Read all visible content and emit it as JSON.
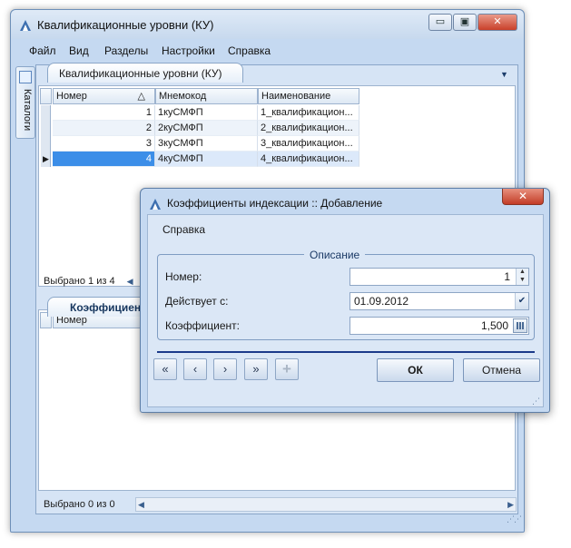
{
  "main_window": {
    "title": "Квалификационные уровни (КУ)",
    "caption_buttons": {
      "minimize": "▭",
      "maximize": "▣",
      "close": "✕"
    }
  },
  "menu": [
    "Файл",
    "Вид",
    "Разделы",
    "Настройки",
    "Справка"
  ],
  "side_tab": {
    "label": "Каталоги"
  },
  "doc_tab": {
    "label": "Квалификационные уровни (КУ)"
  },
  "grid1": {
    "columns": [
      "Номер",
      "Мнемокод",
      "Наименование"
    ],
    "sort_indicator": "△",
    "rows": [
      {
        "num": "1",
        "code": "1куСМФП",
        "name": "1_квалификацион..."
      },
      {
        "num": "2",
        "code": "2куСМФП",
        "name": "2_квалификацион..."
      },
      {
        "num": "3",
        "code": "3куСМФП",
        "name": "3_квалификацион..."
      },
      {
        "num": "4",
        "code": "4куСМФП",
        "name": "4_квалификацион..."
      }
    ],
    "status": "Выбрано 1 из 4"
  },
  "lower_tab": {
    "label": "Коэффициенты"
  },
  "grid2": {
    "columns": [
      "Номер"
    ],
    "status": "Выбрано 0 из 0"
  },
  "dialog": {
    "title": "Коэффициенты индексации :: Добавление",
    "close": "✕",
    "menu": "Справка",
    "group": "Описание",
    "fields": {
      "number_label": "Номер:",
      "number_value": "1",
      "date_label": "Действует с:",
      "date_value": "01.09.2012",
      "coef_label": "Коэффициент:",
      "coef_value": "1,500"
    },
    "nav": {
      "first": "«",
      "prev": "‹",
      "next": "›",
      "last": "»",
      "add": "+"
    },
    "ok": "ОК",
    "cancel": "Отмена"
  },
  "colors": {
    "window_bg": "#c5d9f1",
    "selection": "#3c8ee8",
    "accent": "#1b3a8a"
  }
}
